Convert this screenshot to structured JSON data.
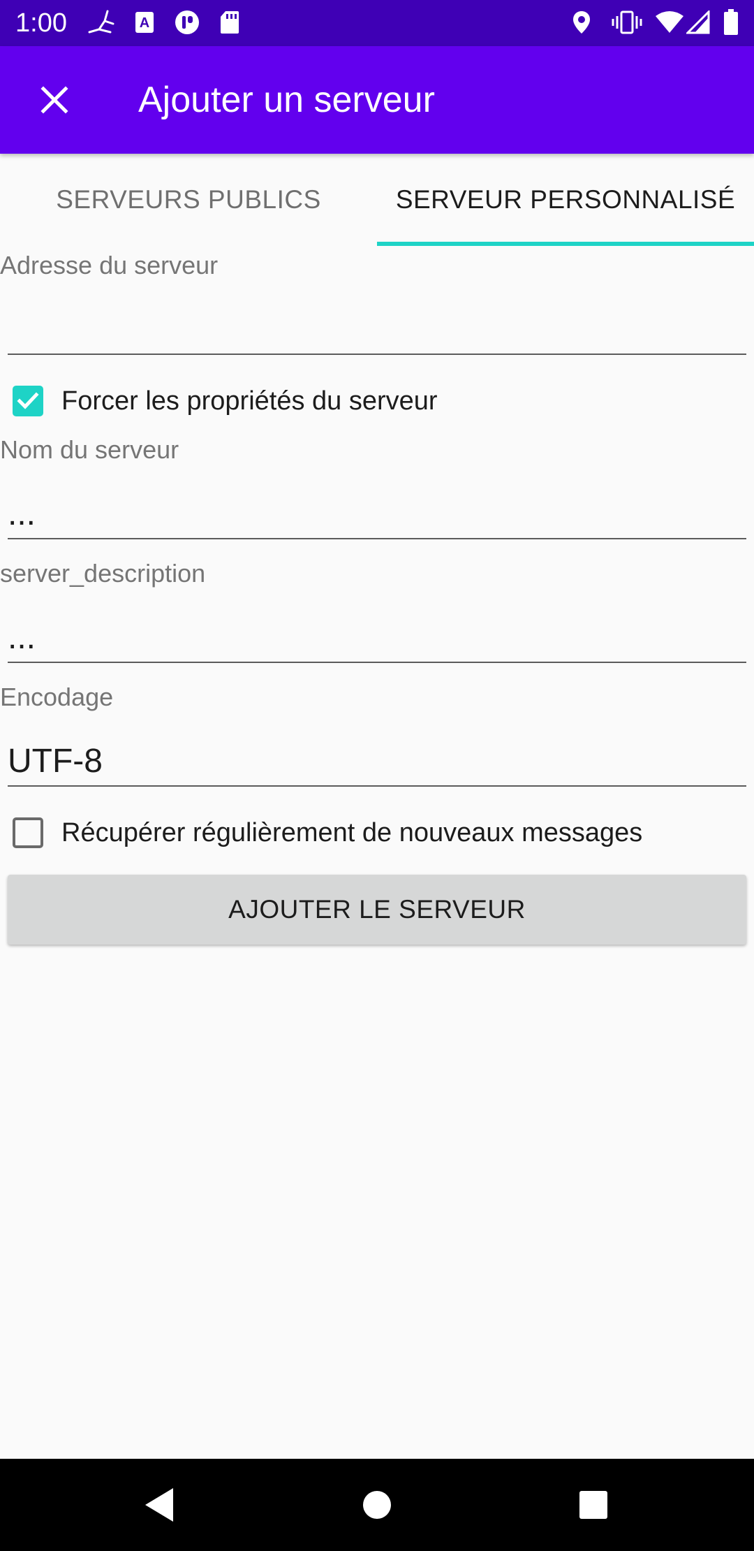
{
  "status_bar": {
    "time": "1:00",
    "left_icons": [
      "fingerprint-icon",
      "a-box-icon",
      "lock-pill-icon",
      "sd-card-icon"
    ],
    "right_icons": [
      "location-icon",
      "vibrate-icon",
      "wifi-icon",
      "signal-icon",
      "battery-icon"
    ]
  },
  "app_bar": {
    "close_icon": "close-icon",
    "title": "Ajouter un serveur"
  },
  "tabs": [
    {
      "label": "SERVEURS PUBLICS",
      "selected": false
    },
    {
      "label": "SERVEUR PERSONNALISÉ",
      "selected": true
    }
  ],
  "form": {
    "server_address": {
      "label": "Adresse du serveur",
      "value": ""
    },
    "force_properties": {
      "label": "Forcer les propriétés du serveur",
      "checked": true
    },
    "server_name": {
      "label": "Nom du serveur",
      "value": "..."
    },
    "server_description": {
      "label": "server_description",
      "value": "..."
    },
    "encoding": {
      "label": "Encodage",
      "value": "UTF-8"
    },
    "fetch_messages": {
      "label": "Récupérer régulièrement de nouveaux messages",
      "checked": false
    },
    "add_button_label": "AJOUTER LE SERVEUR"
  },
  "nav_bar": {
    "buttons": [
      "back-icon",
      "home-icon",
      "recents-icon"
    ]
  },
  "colors": {
    "status_bar": "#3f00b5",
    "app_bar": "#6200ee",
    "accent": "#1ed3c6",
    "background": "#fafafa",
    "button": "#d6d7d7"
  }
}
